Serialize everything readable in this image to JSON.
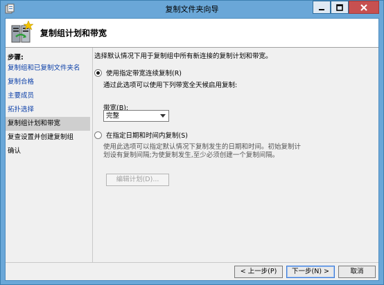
{
  "window": {
    "title": "复制文件夹向导"
  },
  "header": {
    "title": "复制组计划和带宽"
  },
  "steps": {
    "title": "步骤:",
    "items": [
      {
        "label": "复制组和已复制文件夹名",
        "state": "done"
      },
      {
        "label": "复制合格",
        "state": "done"
      },
      {
        "label": "主要成员",
        "state": "done"
      },
      {
        "label": "拓扑选择",
        "state": "done"
      },
      {
        "label": "复制组计划和带宽",
        "state": "current"
      },
      {
        "label": "复查设置并创建复制组",
        "state": "future"
      },
      {
        "label": "确认",
        "state": "future"
      }
    ]
  },
  "main": {
    "description": "选择默认情况下用于复制组中所有新连接的复制计划和带宽。",
    "option_continuous": {
      "label": "使用指定带宽连续复制(R)",
      "checked": true,
      "hint": "通过此选项可以使用下列带宽全天候启用复制:"
    },
    "bandwidth": {
      "label": "带宽(B):",
      "value": "完整"
    },
    "option_schedule": {
      "label": "在指定日期和时间内复制(S)",
      "checked": false,
      "hint_line1": "使用此选项可以指定默认情况下复制发生的日期和时间。初始复制计",
      "hint_line2": "划设有复制间隔;为使复制发生,至少必须创建一个复制间隔。"
    },
    "edit_schedule_button": "编辑计划(D)..."
  },
  "footer": {
    "back_button": "< 上一步(P)",
    "next_button": "下一步(N) >",
    "cancel_button": "取消"
  },
  "colors": {
    "titlebar": "#6aa7d8",
    "close_button": "#c75050",
    "link_text": "#0b3fa8",
    "current_step_bg": "#cfcfcf"
  },
  "icons": [
    "wizard-app-icon",
    "minimize-icon",
    "maximize-icon",
    "close-icon",
    "replication-server-icon",
    "chevron-down-icon"
  ]
}
